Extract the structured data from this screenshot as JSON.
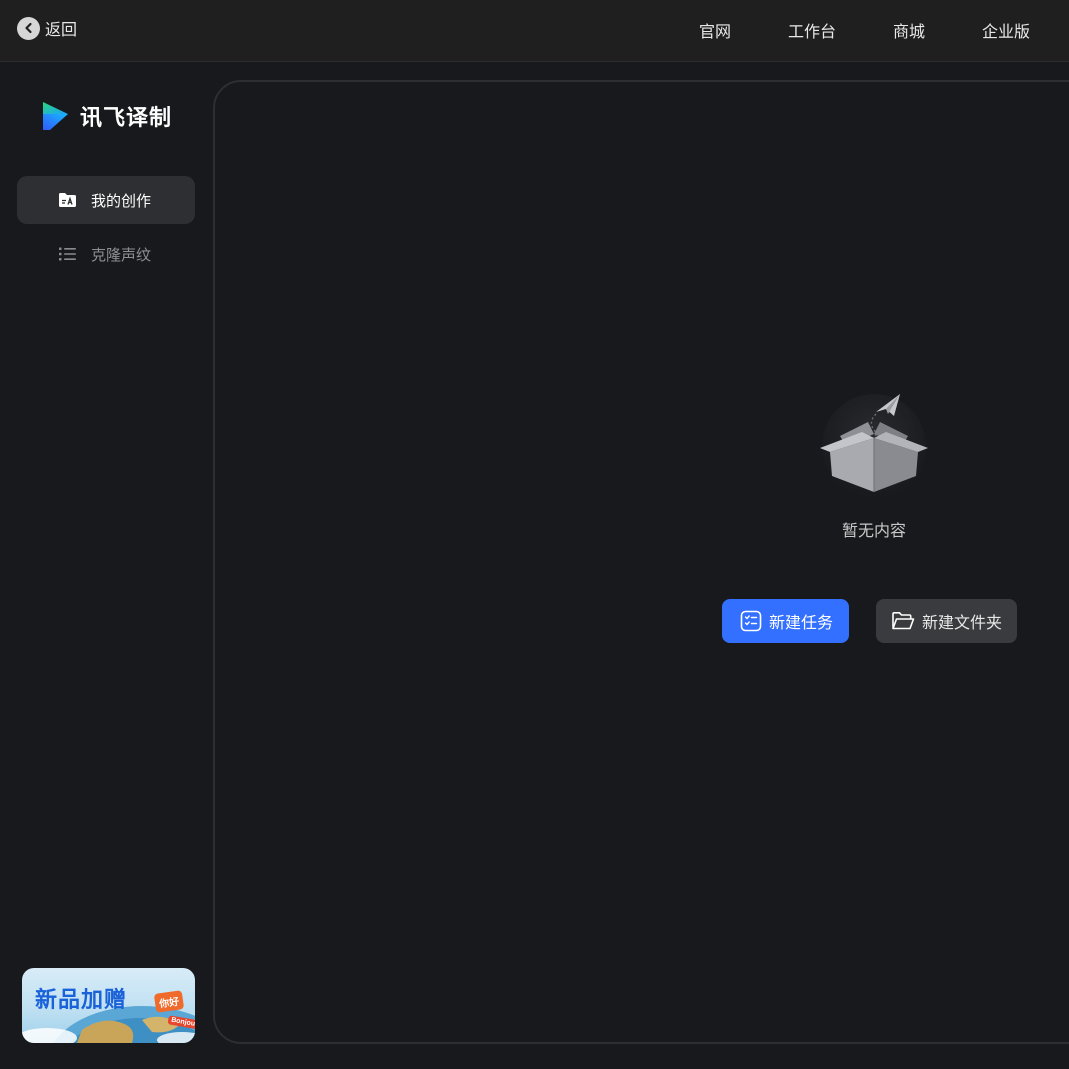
{
  "header": {
    "back_label": "返回",
    "nav": [
      "官网",
      "工作台",
      "商城",
      "企业版"
    ]
  },
  "sidebar": {
    "logo_text": "讯飞译制",
    "items": [
      {
        "label": "我的创作",
        "icon": "folder-translate-icon",
        "active": true
      },
      {
        "label": "克隆声纹",
        "icon": "list-icon",
        "active": false
      }
    ],
    "promo": {
      "title": "新品加赠",
      "bubbles": [
        "你好",
        "Bonjour"
      ]
    }
  },
  "main": {
    "empty_text": "暂无内容",
    "new_task_label": "新建任务",
    "new_folder_label": "新建文件夹"
  },
  "colors": {
    "accent": "#3370ff",
    "background": "#18191c",
    "active_item": "#2e2f32"
  }
}
